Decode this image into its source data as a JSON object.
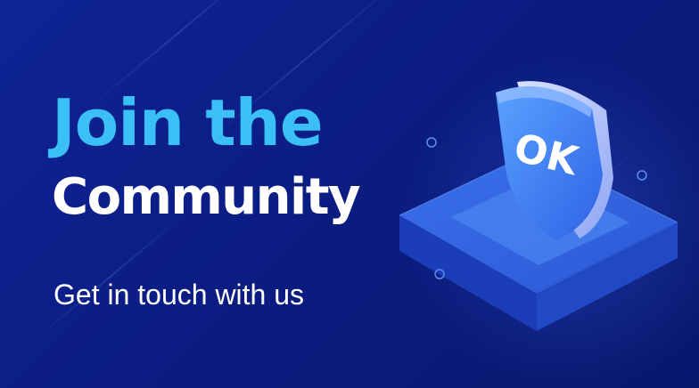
{
  "banner": {
    "title_line1": "Join the",
    "title_line2": "Community",
    "subtitle": "Get in touch with us",
    "shield_text": "OK",
    "colors": {
      "background": "#0b1d83",
      "title_accent": "#3bbff7",
      "title_white": "#ffffff",
      "platform_top": "#2f64e0",
      "shield": "#4c8ef6"
    },
    "icons": [
      "shield-ok-icon",
      "platform-icon",
      "dot-icon"
    ]
  }
}
